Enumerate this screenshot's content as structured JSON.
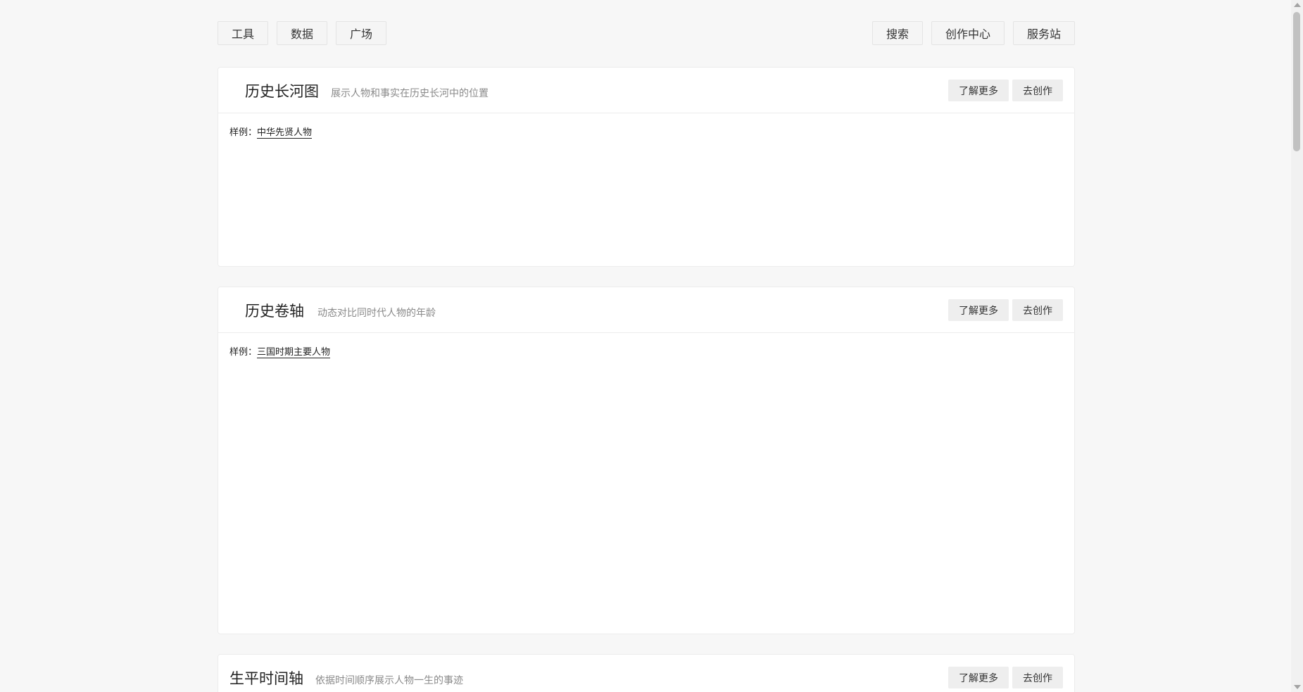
{
  "nav": {
    "left": [
      "工具",
      "数据",
      "广场"
    ],
    "right": [
      "搜索",
      "创作中心",
      "服务站"
    ]
  },
  "cards": [
    {
      "title": "历史长河图",
      "desc": "展示人物和事实在历史长河中的位置",
      "learn_more": "了解更多",
      "create": "去创作",
      "sample_label": "样例：",
      "sample_link": "中华先贤人物"
    },
    {
      "title": "历史卷轴",
      "desc": "动态对比同时代人物的年龄",
      "learn_more": "了解更多",
      "create": "去创作",
      "sample_label": "样例：",
      "sample_link": "三国时期主要人物"
    },
    {
      "title": "生平时间轴",
      "desc": "依据时间顺序展示人物一生的事迹",
      "learn_more": "了解更多",
      "create": "去创作"
    }
  ]
}
